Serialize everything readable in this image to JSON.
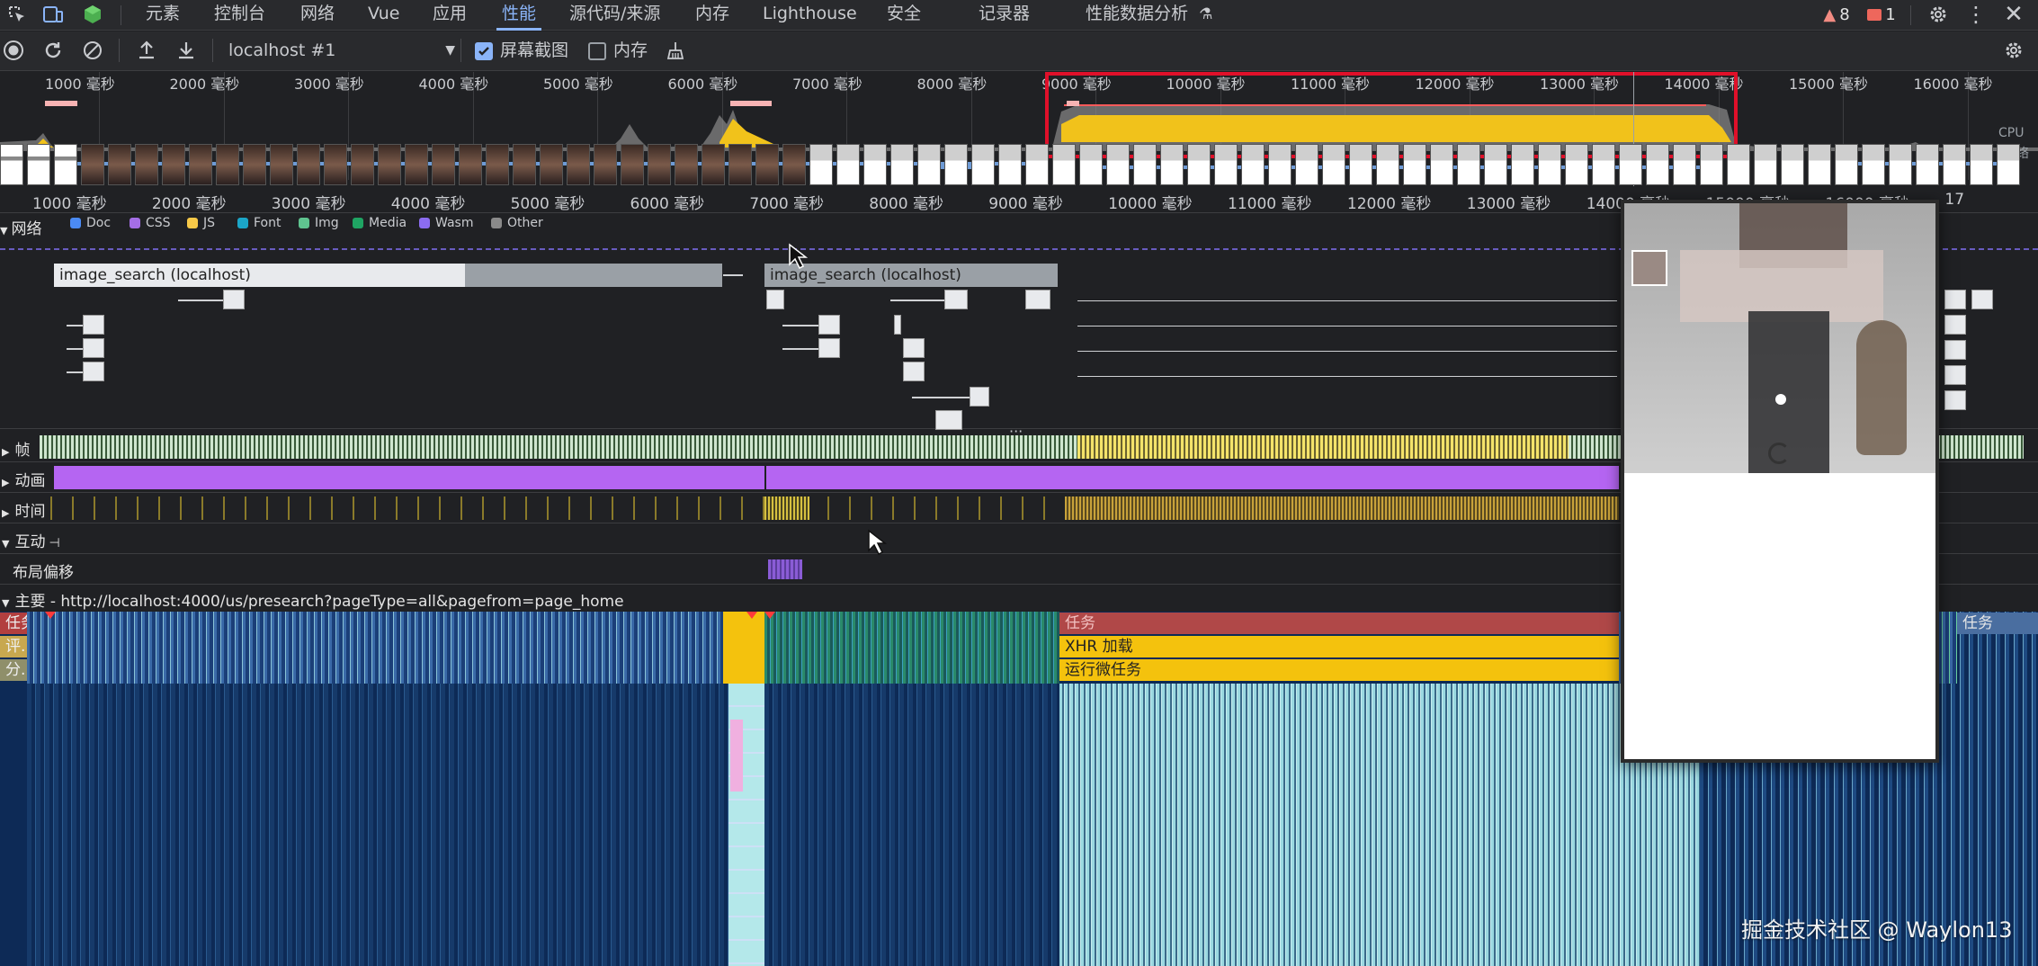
{
  "tabbar": {
    "tabs": [
      {
        "label": "元素",
        "active": false
      },
      {
        "label": "控制台",
        "active": false
      },
      {
        "label": "网络",
        "active": false
      },
      {
        "label": "Vue",
        "active": false
      },
      {
        "label": "应用",
        "active": false
      },
      {
        "label": "性能",
        "active": true
      },
      {
        "label": "源代码/来源",
        "active": false
      },
      {
        "label": "内存",
        "active": false
      },
      {
        "label": "Lighthouse",
        "active": false
      },
      {
        "label": "安全",
        "active": false
      },
      {
        "label": "记录器",
        "active": false
      },
      {
        "label": "性能数据分析",
        "active": false
      }
    ],
    "warnings_count": "8",
    "errors_count": "1"
  },
  "toolbar": {
    "target": "localhost #1",
    "screenshots_label": "屏幕截图",
    "screenshots_checked": true,
    "memory_label": "内存",
    "memory_checked": false
  },
  "overview": {
    "ticks": [
      "1000 毫秒",
      "2000 毫秒",
      "3000 毫秒",
      "4000 毫秒",
      "5000 毫秒",
      "6000 毫秒",
      "7000 毫秒",
      "8000 毫秒",
      "9000 毫秒",
      "10000 毫秒",
      "11000 毫秒",
      "12000 毫秒",
      "13000 毫秒",
      "14000 毫秒",
      "15000 毫秒",
      "16000 毫秒"
    ],
    "cpu_label": "CPU",
    "net_label": "网络"
  },
  "ruler": {
    "ticks": [
      "1000 毫秒",
      "2000 毫秒",
      "3000 毫秒",
      "4000 毫秒",
      "5000 毫秒",
      "6000 毫秒",
      "7000 毫秒",
      "8000 毫秒",
      "9000 毫秒",
      "10000 毫秒",
      "11000 毫秒",
      "12000 毫秒",
      "13000 毫秒",
      "14000 毫秒",
      "15000 毫秒",
      "16000 毫秒",
      "17"
    ]
  },
  "network": {
    "label": "网络",
    "legend": [
      "Doc",
      "CSS",
      "JS",
      "Font",
      "Img",
      "Media",
      "Wasm",
      "Other"
    ],
    "legend_colors": [
      "#4b8bf5",
      "#a46ee6",
      "#f7c948",
      "#1ba6c8",
      "#5fc48f",
      "#1fa463",
      "#8b6cf0",
      "#8a8a8a"
    ],
    "requests": [
      "image_search (localhost)",
      "image_search (localhost)"
    ]
  },
  "tracks": {
    "frames": "帧",
    "animations": "动画",
    "timings": "时间",
    "interactions": "互动",
    "layout_shifts": "布局偏移",
    "main": "主要 - http://localhost:4000/us/presearch?pageType=all&pagefrom=page_home"
  },
  "flame": {
    "left_labels": [
      "任务",
      "评...",
      "分..."
    ],
    "task": "任务",
    "xhr": "XHR 加载",
    "microtasks": "运行微任务",
    "task_right": "任务"
  },
  "watermark": "掘金技术社区 @ Waylon13"
}
